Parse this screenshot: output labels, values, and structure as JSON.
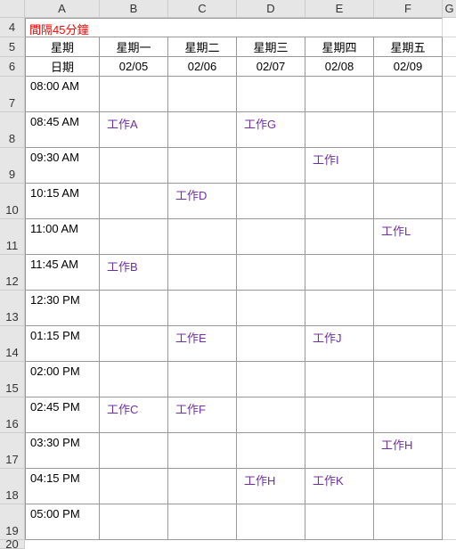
{
  "chart_data": {
    "type": "table",
    "title": "間隔45分鐘",
    "columns": [
      "星期",
      "星期一",
      "星期二",
      "星期三",
      "星期四",
      "星期五"
    ],
    "dates_row": [
      "日期",
      "02/05",
      "02/06",
      "02/07",
      "02/08",
      "02/09"
    ],
    "rows": [
      {
        "time": "08:00 AM",
        "mon": "",
        "tue": "",
        "wed": "",
        "thu": "",
        "fri": ""
      },
      {
        "time": "08:45 AM",
        "mon": "工作A",
        "tue": "",
        "wed": "工作G",
        "thu": "",
        "fri": ""
      },
      {
        "time": "09:30 AM",
        "mon": "",
        "tue": "",
        "wed": "",
        "thu": "工作I",
        "fri": ""
      },
      {
        "time": "10:15 AM",
        "mon": "",
        "tue": "工作D",
        "wed": "",
        "thu": "",
        "fri": ""
      },
      {
        "time": "11:00 AM",
        "mon": "",
        "tue": "",
        "wed": "",
        "thu": "",
        "fri": "工作L"
      },
      {
        "time": "11:45 AM",
        "mon": "工作B",
        "tue": "",
        "wed": "",
        "thu": "",
        "fri": ""
      },
      {
        "time": "12:30 PM",
        "mon": "",
        "tue": "",
        "wed": "",
        "thu": "",
        "fri": ""
      },
      {
        "time": "01:15 PM",
        "mon": "",
        "tue": "工作E",
        "wed": "",
        "thu": "工作J",
        "fri": ""
      },
      {
        "time": "02:00 PM",
        "mon": "",
        "tue": "",
        "wed": "",
        "thu": "",
        "fri": ""
      },
      {
        "time": "02:45 PM",
        "mon": "工作C",
        "tue": "工作F",
        "wed": "",
        "thu": "",
        "fri": ""
      },
      {
        "time": "03:30 PM",
        "mon": "",
        "tue": "",
        "wed": "",
        "thu": "",
        "fri": "工作H"
      },
      {
        "time": "04:15 PM",
        "mon": "",
        "tue": "",
        "wed": "工作H",
        "thu": "工作K",
        "fri": ""
      },
      {
        "time": "05:00 PM",
        "mon": "",
        "tue": "",
        "wed": "",
        "thu": "",
        "fri": ""
      }
    ]
  },
  "col_letters": [
    "A",
    "B",
    "C",
    "D",
    "E",
    "F",
    "G"
  ],
  "row_numbers": [
    "4",
    "5",
    "6",
    "7",
    "8",
    "9",
    "10",
    "11",
    "12",
    "13",
    "14",
    "15",
    "16",
    "17",
    "18",
    "19",
    "20"
  ]
}
